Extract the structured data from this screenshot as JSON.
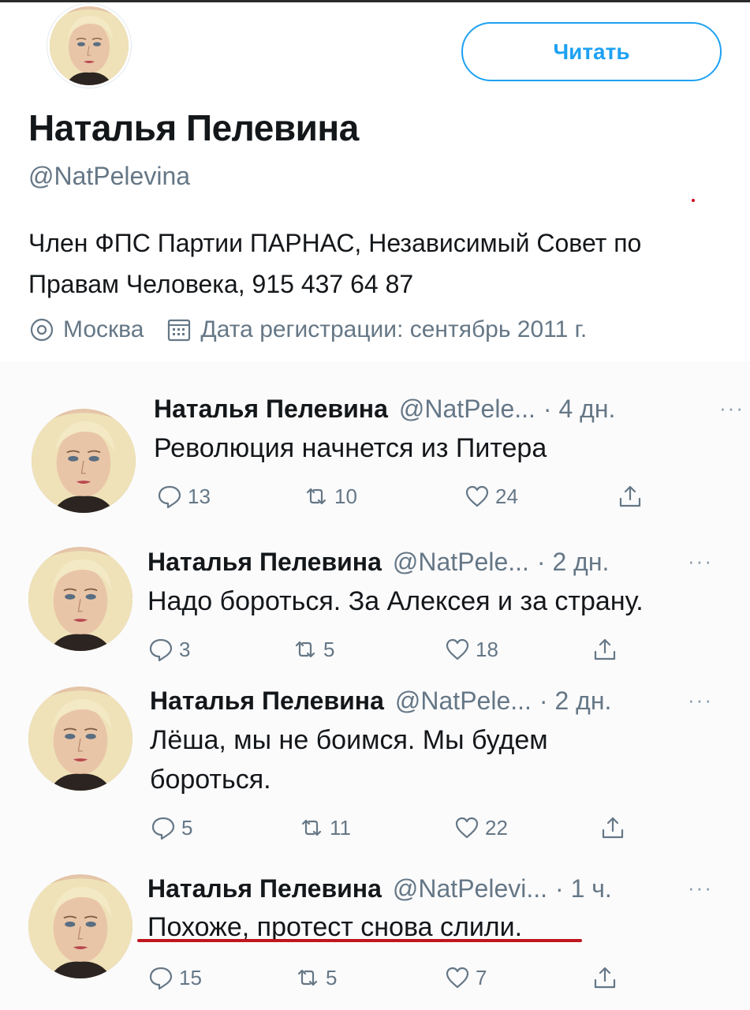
{
  "profile": {
    "name": "Наталья Пелевина",
    "handle": "@NatPelevina",
    "bio": "Член ФПС Партии ПАРНАС, Независимый Совет по Правам Человека, 915 437 64 87",
    "location": "Москва",
    "joined": "Дата регистрации: сентябрь 2011 г.",
    "follow_label": "Читать"
  },
  "tweets": [
    {
      "name": "Наталья Пелевина",
      "handle": "@NatPele...",
      "time": "· 4 дн.",
      "text": "Революция начнется из Питера",
      "replies": "13",
      "retweets": "10",
      "likes": "24"
    },
    {
      "name": "Наталья Пелевина",
      "handle": "@NatPele...",
      "time": "· 2 дн.",
      "text": "Надо бороться. За Алексея и за страну.",
      "replies": "3",
      "retweets": "5",
      "likes": "18"
    },
    {
      "name": "Наталья Пелевина",
      "handle": "@NatPele...",
      "time": "· 2 дн.",
      "text": "Лёша, мы не боимся. Мы будем бороться.",
      "replies": "5",
      "retweets": "11",
      "likes": "22"
    },
    {
      "name": "Наталья Пелевина",
      "handle": "@NatPelevi...",
      "time": "· 1 ч.",
      "text": "Похоже, протест снова слили.",
      "replies": "15",
      "retweets": "5",
      "likes": "7"
    }
  ],
  "more_glyph": "···",
  "colors": {
    "accent": "#1da1f2",
    "secondary_text": "#657786",
    "highlight_underline": "#c0161f"
  },
  "icons": {
    "reply": "reply-icon",
    "retweet": "retweet-icon",
    "like": "heart-icon",
    "share": "share-icon",
    "location": "location-pin-icon",
    "calendar": "calendar-icon"
  }
}
